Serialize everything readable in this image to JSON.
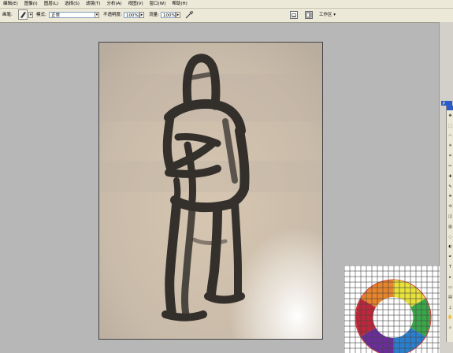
{
  "menu": [
    "编辑(E)",
    "图像(I)",
    "图层(L)",
    "选择(S)",
    "滤镜(T)",
    "分析(A)",
    "视图(V)",
    "窗口(W)",
    "帮助(H)"
  ],
  "options": {
    "brush_label": "画笔:",
    "brush_size": "",
    "mode_label": "模式:",
    "mode_value": "正常",
    "opacity_label": "不透明度:",
    "opacity_value": "100%",
    "flow_label": "流量:",
    "flow_value": "100%",
    "workspace_label": "工作区"
  },
  "toolbox": {
    "panel_letter": "P",
    "tools": [
      "move-icon",
      "marquee-icon",
      "lasso-icon",
      "magic-wand-icon",
      "crop-icon",
      "slice-icon",
      "healing-icon",
      "brush-icon",
      "stamp-icon",
      "history-brush-icon",
      "eraser-icon",
      "gradient-icon",
      "blur-icon",
      "dodge-icon",
      "pen-icon",
      "type-icon",
      "path-select-icon",
      "shape-icon",
      "notes-icon",
      "eyedropper-icon",
      "hand-icon",
      "zoom-icon"
    ],
    "type_glyph": "T"
  },
  "colors": {
    "workspace_bg": "#b7b7b7",
    "canvas_bg": "#cdbfae",
    "stroke": "#1f1c1a",
    "titlebar_blue": "#2a5bc6"
  }
}
